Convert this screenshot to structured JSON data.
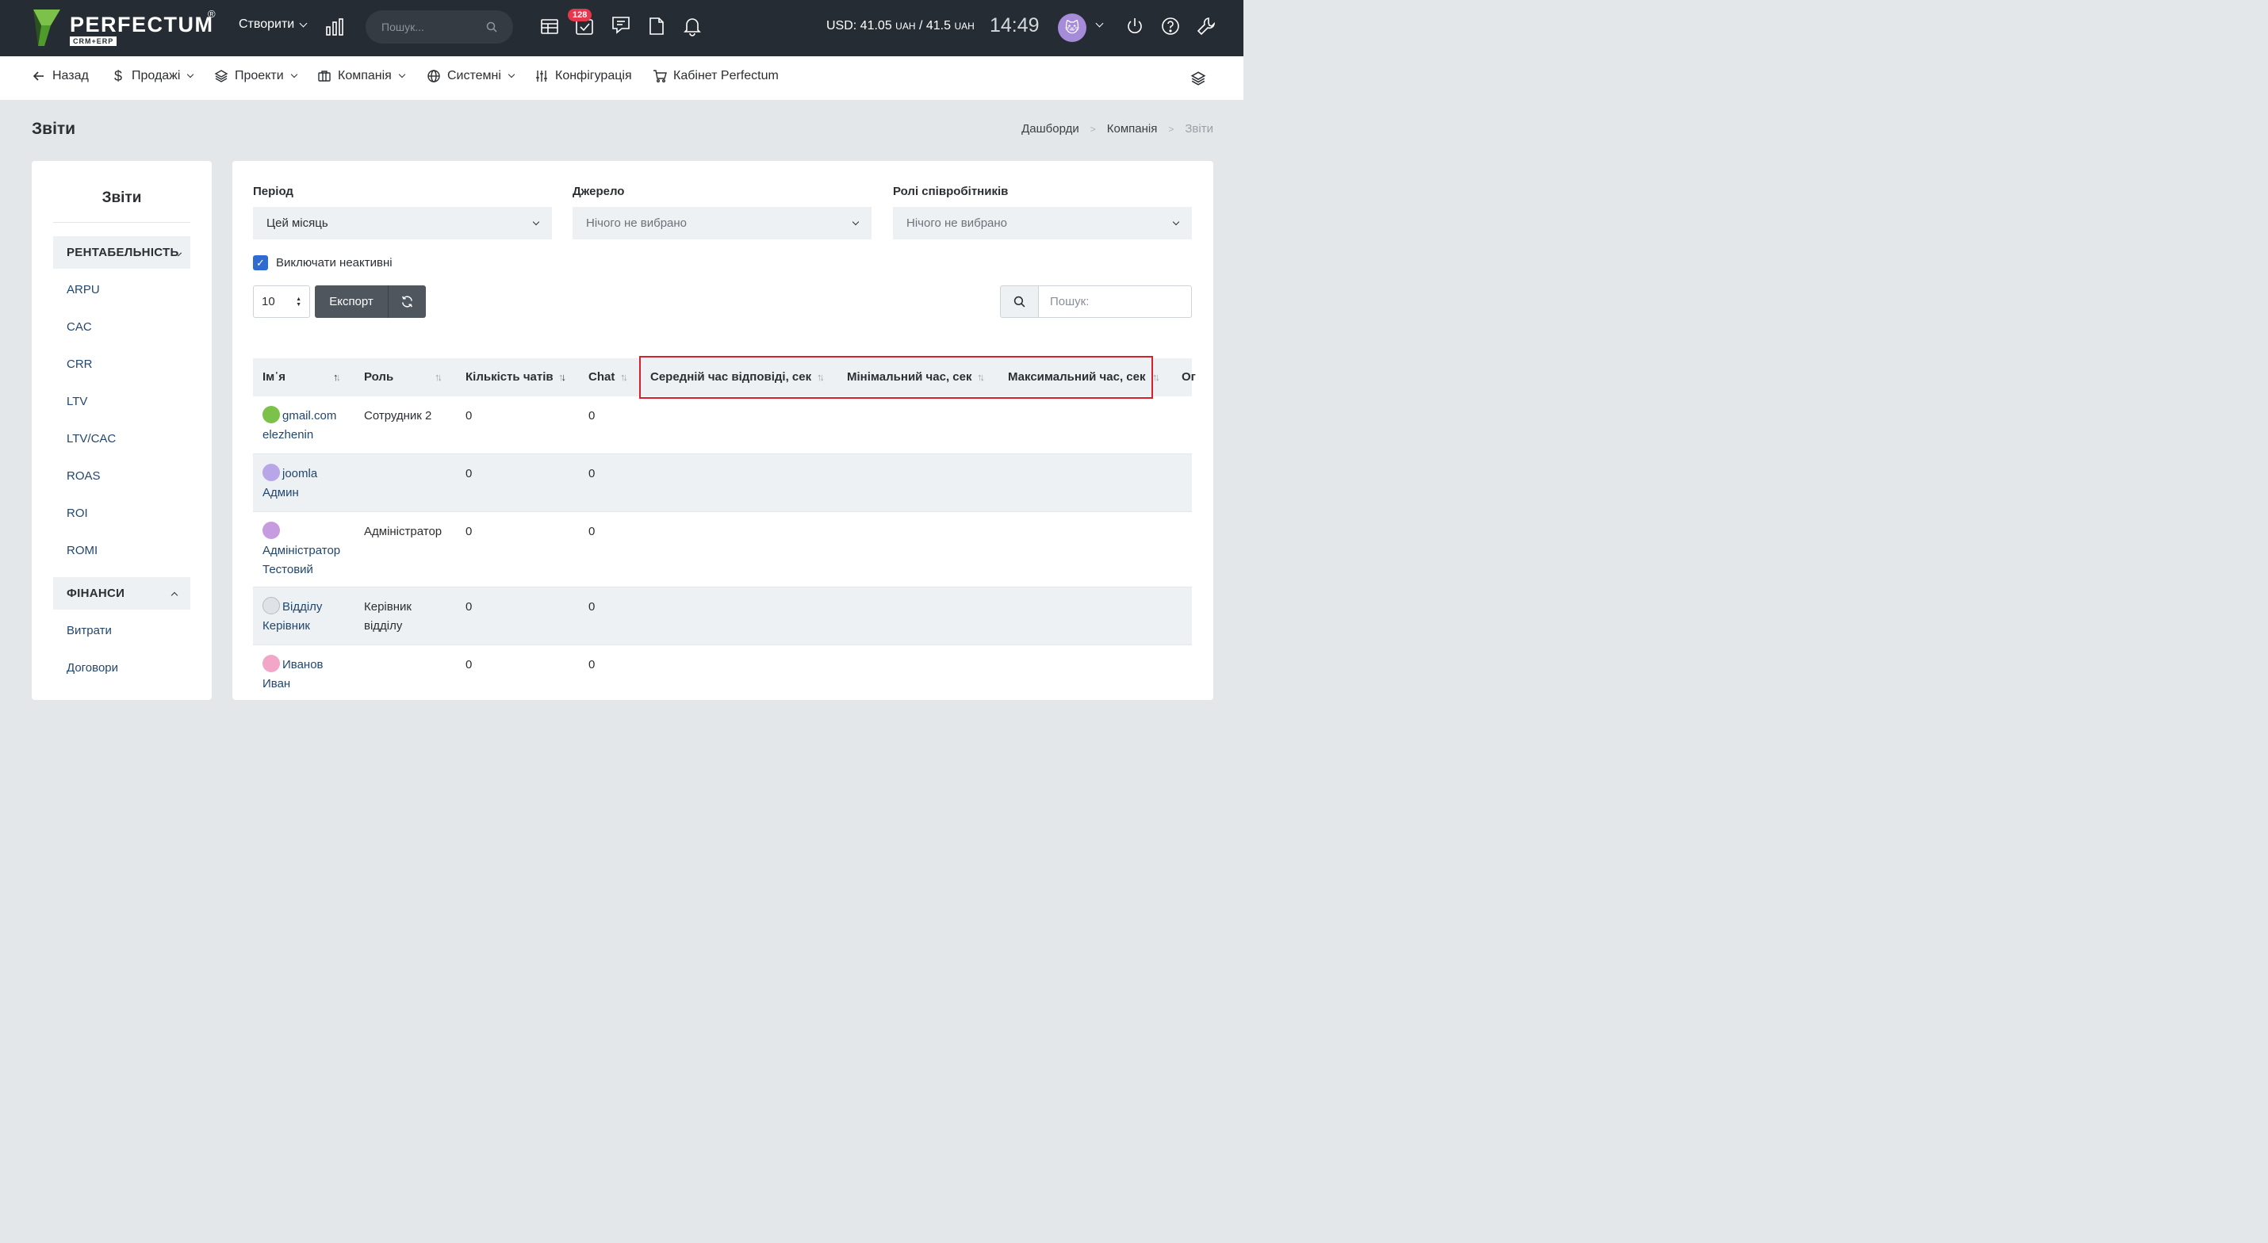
{
  "brand": {
    "name": "PERFECTUM",
    "reg": "®",
    "sub": "CRM+ERP"
  },
  "topbar": {
    "create_label": "Створити",
    "search_placeholder": "Пошук...",
    "tasks_badge": "128",
    "currency_usd": "USD: 41.05",
    "currency_unit1": "UAH",
    "currency_sep": " / 41.5",
    "currency_unit2": "UAH",
    "time": "14:49",
    "avatar": "🐱"
  },
  "nav": {
    "back": "Назад",
    "sales": "Продажі",
    "projects": "Проекти",
    "company": "Компанія",
    "system": "Системні",
    "config": "Конфігурація",
    "cabinet": "Кабінет Perfectum"
  },
  "page": {
    "title": "Звіти",
    "breadcrumb": [
      "Дашборди",
      "Компанія",
      "Звіти"
    ]
  },
  "sidebar": {
    "title": "Звіти",
    "group1": "РЕНТАБЕЛЬНІСТЬ",
    "group1_items": [
      "ARPU",
      "CAC",
      "CRR",
      "LTV",
      "LTV/CAC",
      "ROAS",
      "ROI",
      "ROMI"
    ],
    "group2": "ФІНАНСИ",
    "group2_items": [
      "Витрати",
      "Договори"
    ]
  },
  "filters": {
    "period_label": "Період",
    "period_value": "Цей місяць",
    "source_label": "Джерело",
    "source_value": "Нічого не вибрано",
    "roles_label": "Ролі співробітників",
    "roles_value": "Нічого не вибрано",
    "exclude_inactive": "Виключати неактивні",
    "exclude_inactive_checked": true
  },
  "toolbar": {
    "page_length": "10",
    "export": "Експорт",
    "search_placeholder": "Пошук:"
  },
  "table": {
    "columns": [
      "Ім᾽я",
      "Роль",
      "Кількість чатів",
      "Chat",
      "Середній час відповіді, сек",
      "Мінімальний час, сек",
      "Максимальний час, сек",
      "Ог"
    ],
    "rows": [
      {
        "name1": "gmail.com",
        "name2": "elezhenin",
        "role1": "Сотрудник 2",
        "role2": "",
        "chats": "0",
        "chat": "0",
        "avatar_color": "#7cc24a"
      },
      {
        "name1": "joomla",
        "name2": "Админ",
        "role1": "",
        "role2": "",
        "chats": "0",
        "chat": "0",
        "avatar_color": "#b8a6e8"
      },
      {
        "name1": "",
        "name2": "Адміністратор",
        "name3": "Тестовий",
        "role1": "Адміністратор",
        "role2": "",
        "chats": "0",
        "chat": "0",
        "avatar_color": "#c69be0"
      },
      {
        "name1": "Відділу",
        "name2": "Керівник",
        "role1": "Керівник",
        "role2": "відділу",
        "chats": "0",
        "chat": "0",
        "avatar_color": "#dfe3e8"
      },
      {
        "name1": "Иванов",
        "name2": "Иван",
        "role1": "",
        "role2": "",
        "chats": "0",
        "chat": "0",
        "avatar_color": "#f2a7c8"
      }
    ]
  }
}
